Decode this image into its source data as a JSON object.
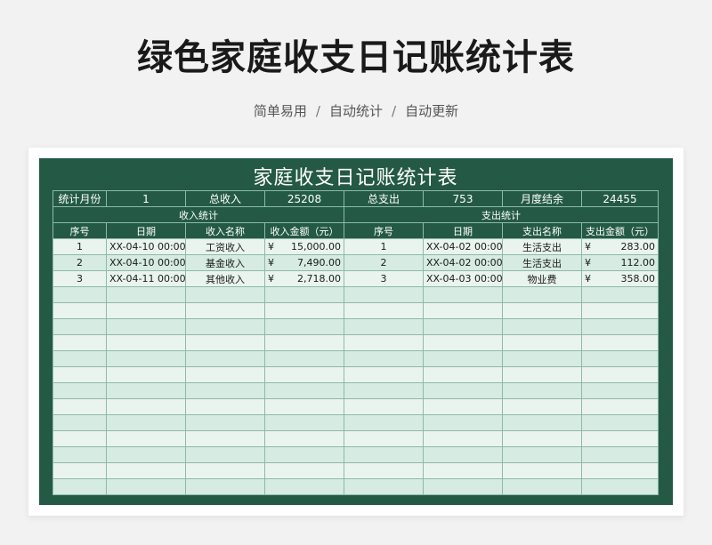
{
  "page": {
    "title": "绿色家庭收支日记账统计表",
    "tags": [
      "简单易用",
      "自动统计",
      "自动更新"
    ],
    "separator": "/"
  },
  "sheet": {
    "title": "家庭收支日记账统计表",
    "summary": {
      "month_label": "统计月份",
      "month_value": "1",
      "income_label": "总收入",
      "income_value": "25208",
      "expense_label": "总支出",
      "expense_value": "753",
      "balance_label": "月度结余",
      "balance_value": "24455"
    },
    "income_section": "收入统计",
    "expense_section": "支出统计",
    "income_headers": [
      "序号",
      "日期",
      "收入名称",
      "收入金额（元）"
    ],
    "expense_headers": [
      "序号",
      "日期",
      "支出名称",
      "支出金额（元）"
    ],
    "currency": "¥",
    "income_rows": [
      {
        "no": "1",
        "date": "XX-04-10 00:00:00",
        "name": "工资收入",
        "amount": "15,000.00"
      },
      {
        "no": "2",
        "date": "XX-04-10 00:00:00",
        "name": "基金收入",
        "amount": "7,490.00"
      },
      {
        "no": "3",
        "date": "XX-04-11 00:00:00",
        "name": "其他收入",
        "amount": "2,718.00"
      }
    ],
    "expense_rows": [
      {
        "no": "1",
        "date": "XX-04-02 00:00:00",
        "name": "生活支出",
        "amount": "283.00"
      },
      {
        "no": "2",
        "date": "XX-04-02 00:00:00",
        "name": "生活支出",
        "amount": "112.00"
      },
      {
        "no": "3",
        "date": "XX-04-03 00:00:00",
        "name": "物业费",
        "amount": "358.00"
      }
    ]
  }
}
